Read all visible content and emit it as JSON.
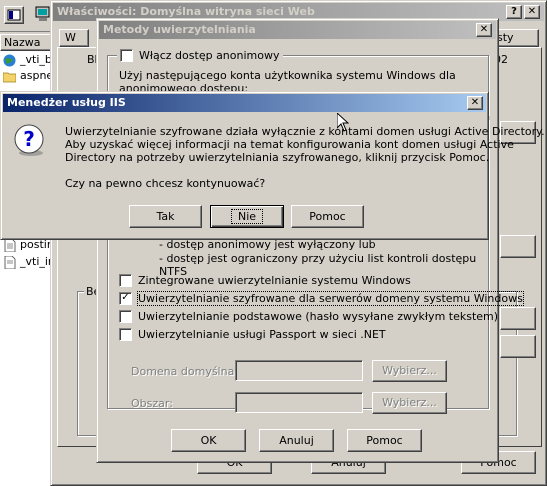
{
  "explorer": {
    "column_header": "Nazwa",
    "items": [
      "_vti_bi",
      "aspnet",
      "postinf",
      "_vti_in"
    ]
  },
  "properties": {
    "title": "Właściwości: Domyślna witryna sieci Web",
    "help_btn": "?",
    "close_btn": "✕",
    "tab_partial_left": "W",
    "tab_partial_right": "sty",
    "partial_left2": "Bk",
    "partial_right2": "02",
    "group_partial": "Be",
    "ok": "OK",
    "cancel": "Anuluj",
    "help": "Pomoc"
  },
  "auth": {
    "title": "Metody uwierzytelniania",
    "close_btn": "✕",
    "anonymous": "Włącz dostęp anonimowy",
    "anon_text_1": "Użyj następującego konta użytkownika systemu Windows dla",
    "anon_text_2": "anonimowego dostępu:",
    "bullet1": "- dostęp anonimowy jest wyłączony lub",
    "bullet2": "- dostęp jest ograniczony przy użyciu list kontroli dostępu NTFS",
    "integrated": "Zintegrowane uwierzytelnianie systemu Windows",
    "digest": "Uwierzytelnianie szyfrowane dla serwerów domeny systemu Windows",
    "basic": "Uwierzytelnianie podstawowe (hasło wysyłane zwykłym tekstem)",
    "passport": "Uwierzytelnianie usługi Passport w sieci .NET",
    "domain_label": "Domena domyślna:",
    "realm_label": "Obszar:",
    "select1": "Wybierz...",
    "select2": "Wybierz...",
    "ok": "OK",
    "cancel": "Anuluj",
    "help": "Pomoc"
  },
  "dialog": {
    "title": "Menedżer usług IIS",
    "close_btn": "✕",
    "icon": "question-icon",
    "message_1": "Uwierzytelnianie szyfrowane działa wyłącznie z kontami domen usługi Active Directory.",
    "message_2": "Aby uzyskać więcej informacji na temat konfigurowania kont domen usługi Active",
    "message_3": "Directory na potrzeby uwierzytelniania szyfrowanego, kliknij przycisk Pomoc.",
    "question": "Czy na pewno chcesz kontynuować?",
    "yes": "Tak",
    "no": "Nie",
    "help": "Pomoc"
  }
}
